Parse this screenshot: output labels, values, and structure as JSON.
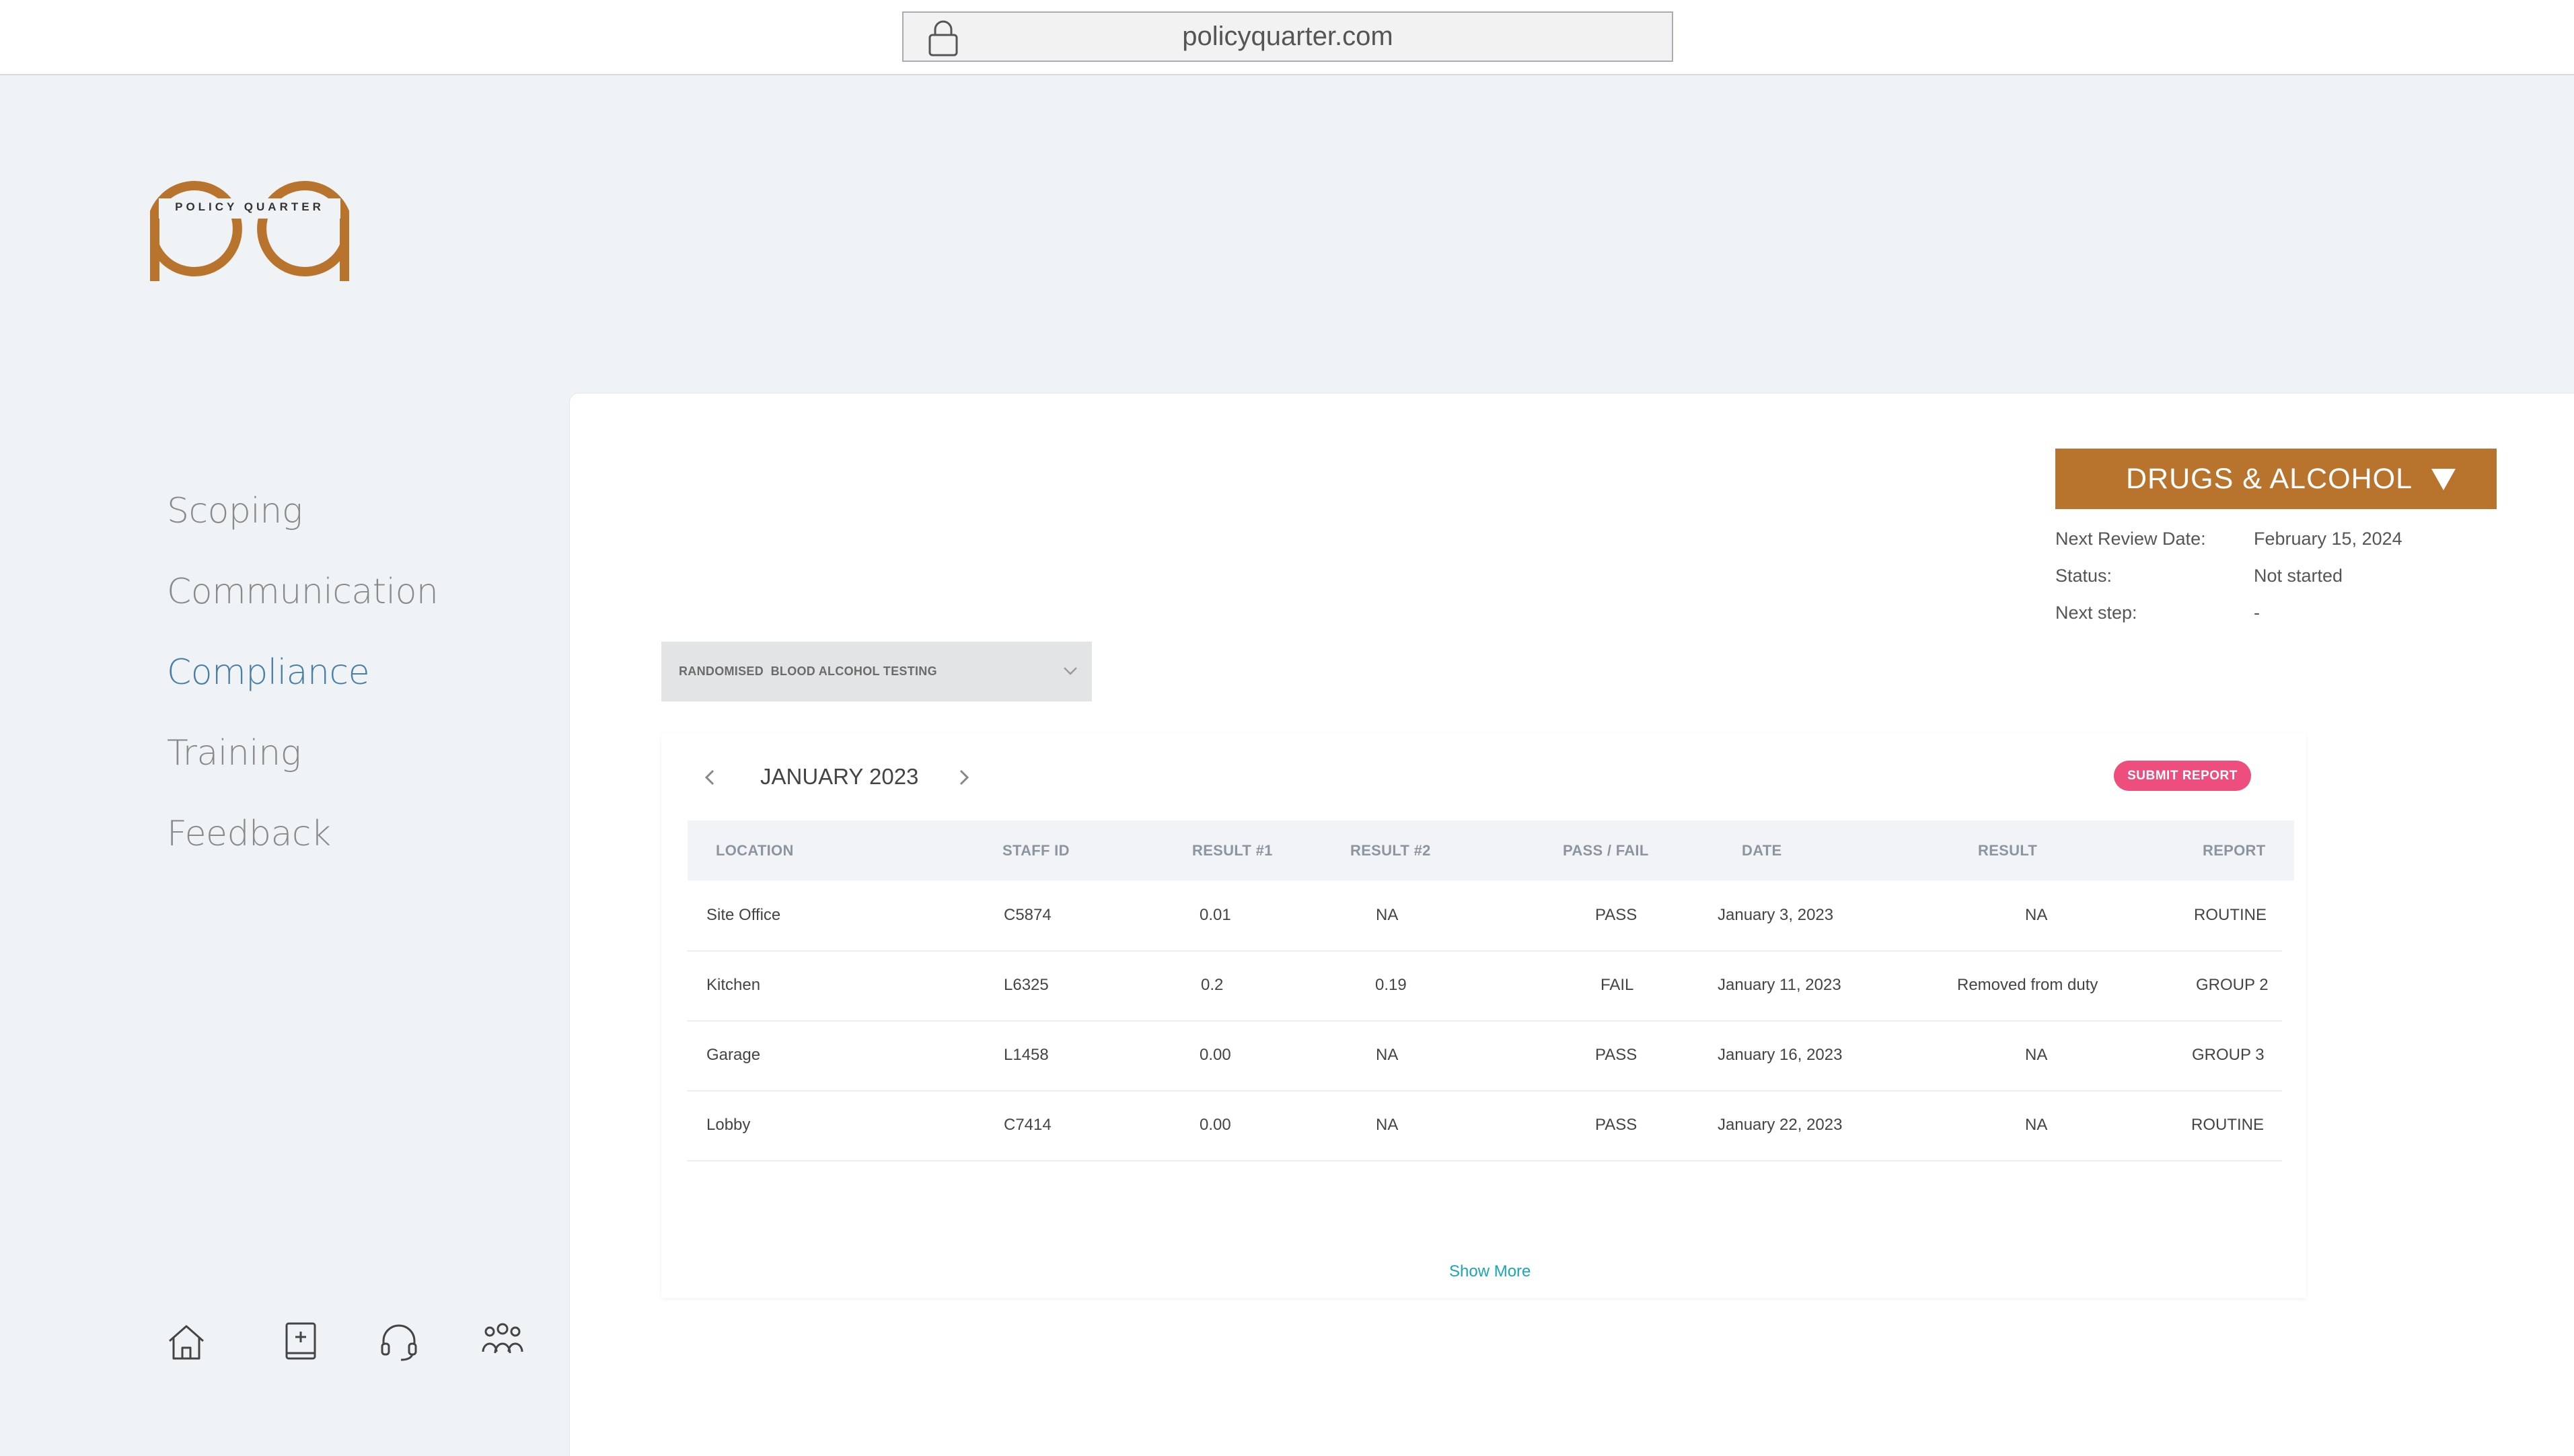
{
  "browser": {
    "url": "policyquarter.com"
  },
  "logo": {
    "text": "POLICY QUARTER"
  },
  "nav": {
    "items": [
      {
        "label": "Scoping",
        "active": false
      },
      {
        "label": "Communication",
        "active": false
      },
      {
        "label": "Compliance",
        "active": true
      },
      {
        "label": "Training",
        "active": false
      },
      {
        "label": "Feedback",
        "active": false
      }
    ],
    "bottom_icons": [
      "home-icon",
      "book-icon",
      "headset-icon",
      "team-icon"
    ]
  },
  "policy": {
    "selector_label": "DRUGS & ALCOHOL",
    "next_review_label": "Next Review Date:",
    "next_review_value": "February 15, 2024",
    "status_label": "Status:",
    "status_value": "Not started",
    "next_step_label": "Next step:",
    "next_step_value": "-"
  },
  "test_type": {
    "selected": "RANDOMISED  BLOOD ALCOHOL TESTING"
  },
  "calendar": {
    "month": "JANUARY 2023"
  },
  "actions": {
    "submit_report": "SUBMIT REPORT",
    "show_more": "Show More"
  },
  "table": {
    "headers": [
      "LOCATION",
      "STAFF ID",
      "RESULT #1",
      "RESULT #2",
      "PASS / FAIL",
      "DATE",
      "RESULT",
      "REPORT"
    ],
    "rows": [
      [
        "Site Office",
        "C5874",
        "0.01",
        "NA",
        "PASS",
        "January 3, 2023",
        "NA",
        "ROUTINE"
      ],
      [
        "Kitchen",
        "L6325",
        "0.2",
        "0.19",
        "FAIL",
        "January 11, 2023",
        "Removed from duty",
        "GROUP 2"
      ],
      [
        "Garage",
        "L1458",
        "0.00",
        "NA",
        "PASS",
        "January 16, 2023",
        "NA",
        "GROUP 3"
      ],
      [
        "Lobby",
        "C7414",
        "0.00",
        "NA",
        "PASS",
        "January 22, 2023",
        "NA",
        "ROUTINE"
      ]
    ]
  },
  "colors": {
    "brand": "#b8742c",
    "active_nav": "#4a7fa5",
    "submit": "#ee4e7d",
    "link": "#1ba5b5"
  }
}
